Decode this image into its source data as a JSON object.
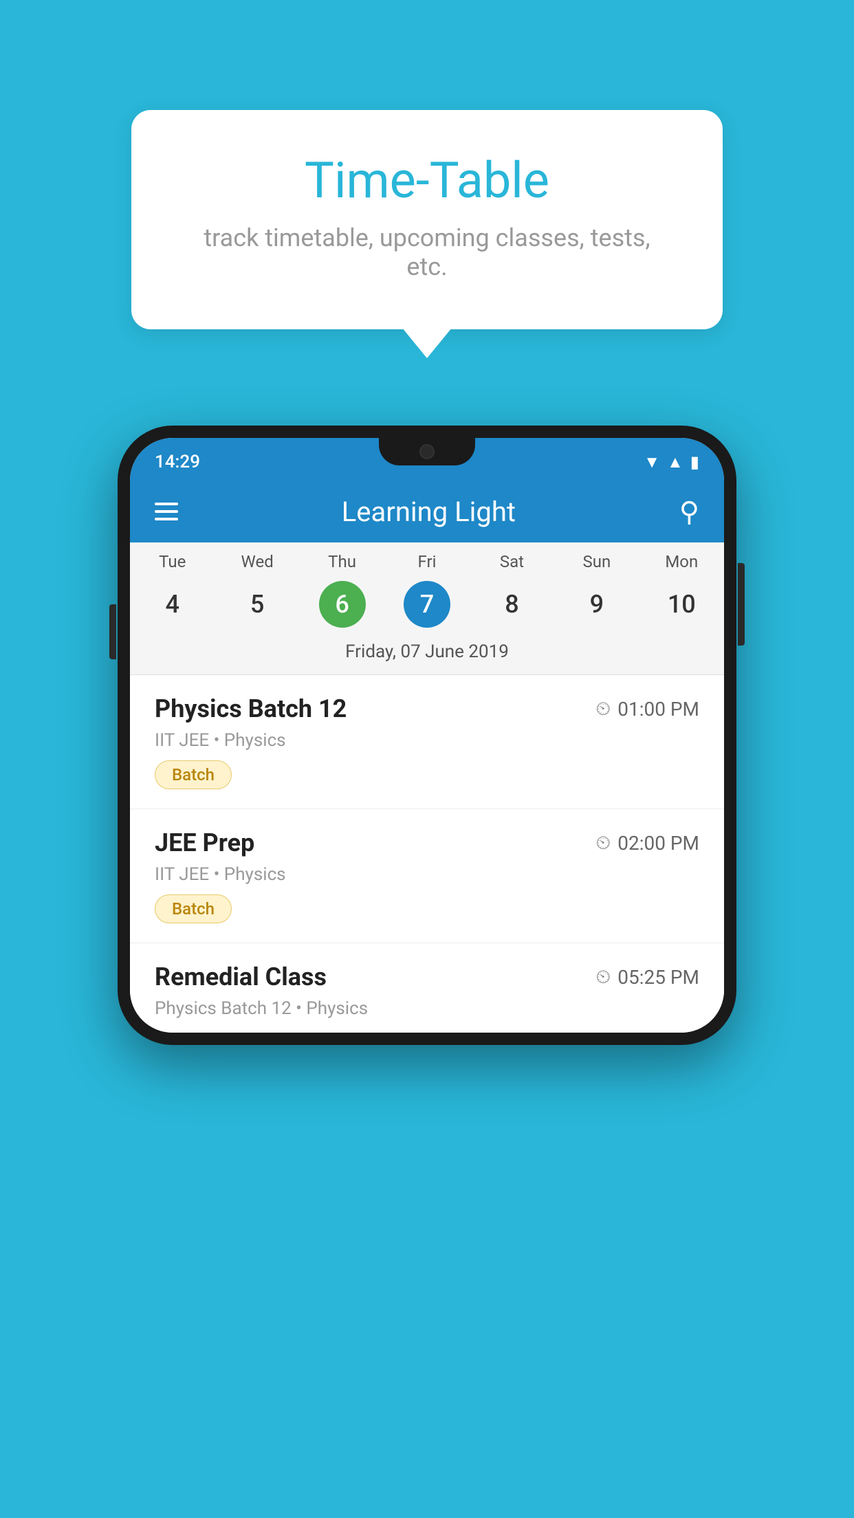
{
  "background": {
    "color": "#29B6D8"
  },
  "speech_bubble": {
    "title": "Time-Table",
    "subtitle": "track timetable, upcoming classes, tests, etc."
  },
  "phone": {
    "status_bar": {
      "time": "14:29"
    },
    "header": {
      "title": "Learning Light",
      "menu_icon": "hamburger-icon",
      "search_icon": "search-icon"
    },
    "calendar": {
      "days": [
        "Tue",
        "Wed",
        "Thu",
        "Fri",
        "Sat",
        "Sun",
        "Mon"
      ],
      "dates": [
        {
          "number": "4",
          "state": "normal"
        },
        {
          "number": "5",
          "state": "normal"
        },
        {
          "number": "6",
          "state": "today"
        },
        {
          "number": "7",
          "state": "selected"
        },
        {
          "number": "8",
          "state": "normal"
        },
        {
          "number": "9",
          "state": "normal"
        },
        {
          "number": "10",
          "state": "normal"
        }
      ],
      "selected_date_label": "Friday, 07 June 2019"
    },
    "schedule": {
      "items": [
        {
          "title": "Physics Batch 12",
          "time": "01:00 PM",
          "meta": "IIT JEE • Physics",
          "badge": "Batch"
        },
        {
          "title": "JEE Prep",
          "time": "02:00 PM",
          "meta": "IIT JEE • Physics",
          "badge": "Batch"
        },
        {
          "title": "Remedial Class",
          "time": "05:25 PM",
          "meta": "Physics Batch 12 • Physics",
          "badge": null,
          "partial": true
        }
      ]
    }
  }
}
